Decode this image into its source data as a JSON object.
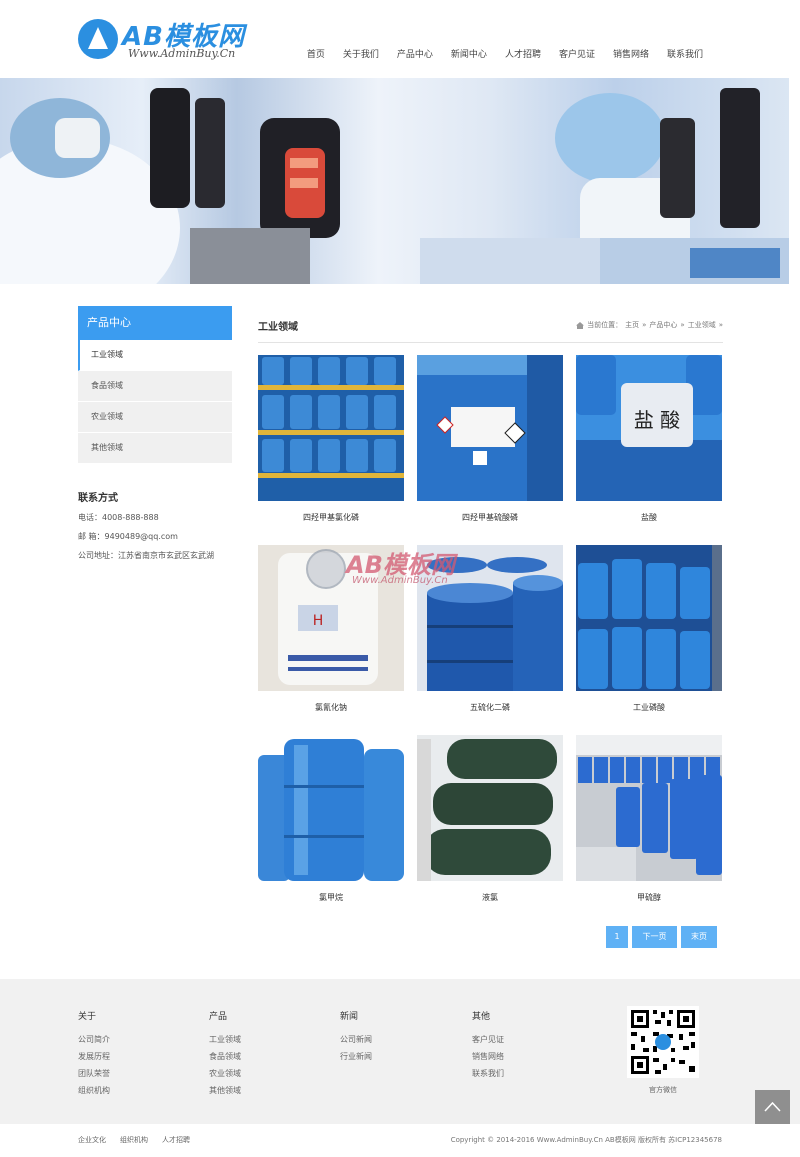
{
  "logo": {
    "name": "AB模板网",
    "sub": "Www.AdminBuy.Cn"
  },
  "nav": [
    "首页",
    "关于我们",
    "产品中心",
    "新闻中心",
    "人才招聘",
    "客户见证",
    "销售网络",
    "联系我们"
  ],
  "sidebar": {
    "title": "产品中心",
    "items": [
      "工业领域",
      "食品领域",
      "农业领域",
      "其他领域"
    ],
    "contact_title": "联系方式",
    "contact": [
      "电话：4008-888-888",
      "邮 箱：9490489@qq.com",
      "公司地址：江苏省南京市玄武区玄武湖"
    ]
  },
  "main": {
    "title": "工业领域",
    "crumbs": [
      "当前位置：",
      "主页",
      "»",
      "产品中心",
      "»",
      "工业领域",
      "»"
    ],
    "products": [
      "四羟甲基氯化磷",
      "四羟甲基硫酸磷",
      "盐酸",
      "氯氰化钠",
      "五硫化二磷",
      "工业磷酸",
      "氯甲烷",
      "液氯",
      "甲硫醇"
    ],
    "salt_label": "盐 酸",
    "watermark": {
      "name": "AB模板网",
      "sub": "Www.AdminBuy.Cn"
    }
  },
  "pager": [
    "1",
    "下一页",
    "末页"
  ],
  "footer": {
    "cols": [
      {
        "title": "关于",
        "links": [
          "公司简介",
          "发展历程",
          "团队荣誉",
          "组织机构"
        ]
      },
      {
        "title": "产品",
        "links": [
          "工业领域",
          "食品领域",
          "农业领域",
          "其他领域"
        ]
      },
      {
        "title": "新闻",
        "links": [
          "公司新闻",
          "行业新闻"
        ]
      },
      {
        "title": "其他",
        "links": [
          "客户见证",
          "销售网络",
          "联系我们"
        ]
      }
    ],
    "qr_label": "官方微信",
    "bottom_links": [
      "企业文化",
      "组织机构",
      "人才招聘"
    ],
    "copyright": "Copyright © 2014-2016 Www.AdminBuy.Cn AB模板网 版权所有    苏ICP12345678"
  },
  "colors": {
    "accent": "#3b9cf0",
    "barrel_blue": "#2a73c8",
    "cylinder_green": "#2f4a3a"
  }
}
